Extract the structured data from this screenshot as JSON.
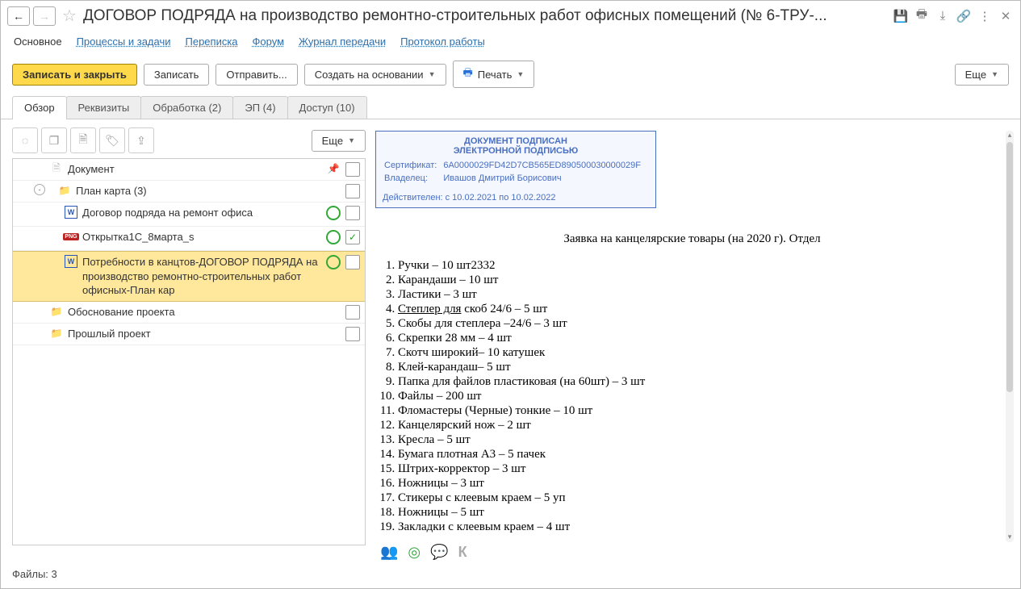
{
  "header": {
    "title": "ДОГОВОР ПОДРЯДА на производство ремонтно-строительных работ офисных помещений (№ 6-ТРУ-..."
  },
  "nav": {
    "items": [
      "Основное",
      "Процессы и задачи",
      "Переписка",
      "Форум",
      "Журнал передачи",
      "Протокол работы"
    ],
    "active": 0
  },
  "cmd": {
    "save_close": "Записать и закрыть",
    "save": "Записать",
    "send": "Отправить...",
    "create_based": "Создать на основании",
    "print": "Печать",
    "more": "Еще"
  },
  "tabs": {
    "items": [
      "Обзор",
      "Реквизиты",
      "Обработка (2)",
      "ЭП (4)",
      "Доступ (10)"
    ],
    "active": 0
  },
  "tree_more": "Еще",
  "tree": {
    "rows": [
      {
        "indent": 34,
        "icon": "doc",
        "label": "Документ",
        "pin": true,
        "green": false,
        "checked": false
      },
      {
        "indent": 14,
        "expander": "-",
        "icon": "folder",
        "label": "План карта (3)",
        "green": false,
        "checked": false
      },
      {
        "indent": 52,
        "icon": "w",
        "label": "Договор подряда на ремонт офиса",
        "green": true,
        "checked": false
      },
      {
        "indent": 52,
        "icon": "png",
        "label": "Открытка1С_8марта_s",
        "green": true,
        "checked": true
      },
      {
        "indent": 52,
        "icon": "w",
        "label": "Потребности в канцтов-ДОГОВОР ПОДРЯДА на производство ремонтно-строительных работ офисных-План кар",
        "green": true,
        "checked": false,
        "selected": true
      },
      {
        "indent": 34,
        "icon": "folder",
        "label": "Обоснование проекта",
        "green": false,
        "checked": false
      },
      {
        "indent": 34,
        "icon": "folder",
        "label": "Прошлый проект",
        "green": false,
        "checked": false
      }
    ]
  },
  "stamp": {
    "line1": "ДОКУМЕНТ ПОДПИСАН",
    "line2": "ЭЛЕКТРОННОЙ ПОДПИСЬЮ",
    "cert_label": "Сертификат:",
    "cert": "6A0000029FD42D7CB565ED890500030000029F",
    "owner_label": "Владелец:",
    "owner": "Ивашов Дмитрий Борисович",
    "valid": "Действителен: с 10.02.2021 по 10.02.2022"
  },
  "preview": {
    "title": "Заявка на канцелярские товары (на 2020 г). Отдел",
    "items": [
      "Ручки – 10 шт2332",
      "Карандаши – 10 шт",
      "Ластики – 3 шт",
      {
        "u": "Степлер для",
        "rest": " скоб 24/6 – 5 шт"
      },
      "Скобы для степлера –24/6 – 3 шт",
      "Скрепки 28 мм – 4 шт",
      "Скотч широкий– 10 катушек",
      "Клей-карандаш– 5 шт",
      "Папка для файлов пластиковая (на 60шт) – 3 шт",
      "Файлы – 200 шт",
      "Фломастеры (Черные) тонкие – 10 шт",
      "Канцелярский нож – 2 шт",
      "Кресла – 5 шт",
      "Бумага плотная А3 – 5 пачек",
      "Штрих-корректор – 3 шт",
      "Ножницы – 3 шт",
      "Стикеры с клеевым краем – 5 уп",
      "Ножницы – 5 шт",
      "Закладки с клеевым краем – 4 шт"
    ]
  },
  "footer": {
    "files": "Файлы:  3"
  }
}
